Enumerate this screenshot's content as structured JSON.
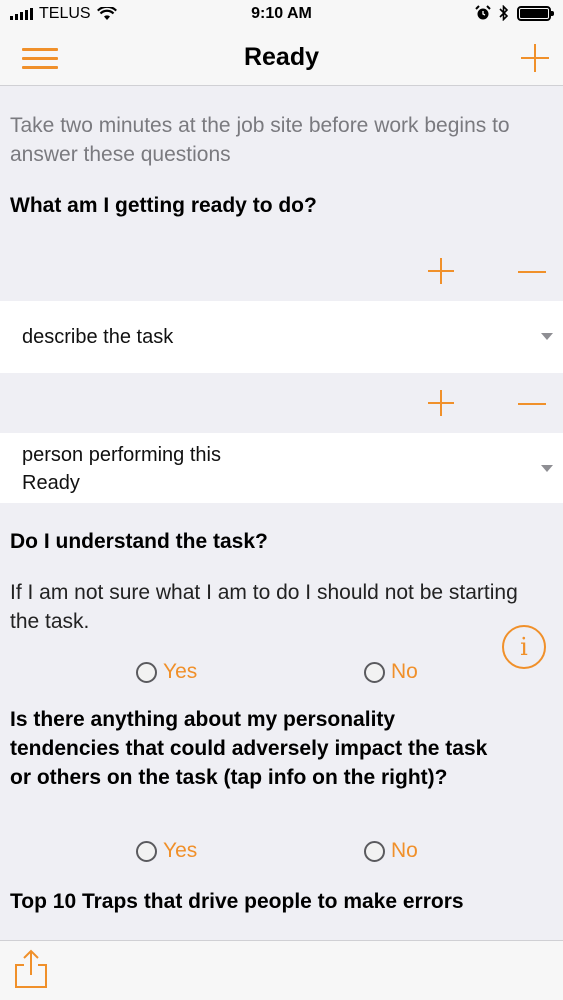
{
  "status_bar": {
    "carrier": "TELUS",
    "time": "9:10 AM",
    "icons": [
      "signal-icon",
      "wifi-icon",
      "alarm-icon",
      "bluetooth-icon",
      "battery-icon"
    ]
  },
  "nav": {
    "title": "Ready",
    "left_icon": "hamburger-menu-icon",
    "right_icon": "plus-icon"
  },
  "accent_color": "#f0902a",
  "intro_text": "Take two minutes at the job site before work begins to answer these questions",
  "section1": {
    "heading": "What am I getting ready to do?",
    "task_select": {
      "value": "describe the task"
    },
    "person_select": {
      "value_line1": "person performing this",
      "value_line2": "Ready"
    }
  },
  "section2": {
    "heading": "Do I understand the task?",
    "body": "If I am not sure what I am to do I should not be starting the task.",
    "options": [
      "Yes",
      "No"
    ]
  },
  "section3": {
    "heading": "Is there anything about my personality tendencies that could adversely impact the task or others on the task (tap info on the right)?",
    "info_glyph": "i",
    "options": [
      "Yes",
      "No"
    ]
  },
  "section4": {
    "heading": "Top 10 Traps that drive people to make errors"
  },
  "toolbar": {
    "icon": "share-icon"
  }
}
